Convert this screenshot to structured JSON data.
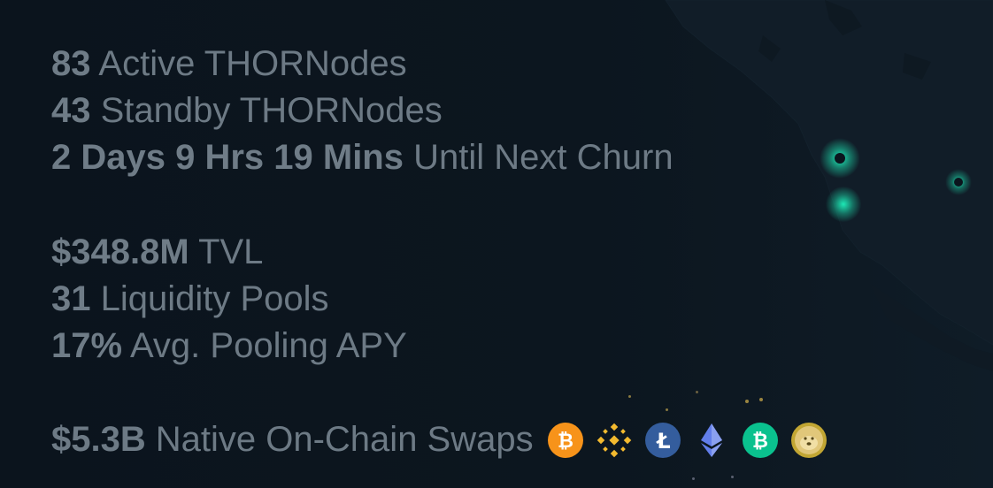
{
  "stats": {
    "active": {
      "value": "83",
      "label": "Active THORNodes"
    },
    "standby": {
      "value": "43",
      "label": "Standby THORNodes"
    },
    "churn": {
      "value": "2 Days 9 Hrs 19 Mins",
      "label": "Until Next Churn"
    },
    "tvl": {
      "value": "$348.8M",
      "label": "TVL"
    },
    "pools": {
      "value": "31",
      "label": "Liquidity Pools"
    },
    "apy": {
      "value": "17%",
      "label": "Avg. Pooling APY"
    },
    "swaps": {
      "value": "$5.3B",
      "label": "Native On-Chain Swaps"
    }
  },
  "coin_icons": [
    "bitcoin-icon",
    "binance-icon",
    "litecoin-icon",
    "ethereum-icon",
    "bitcoin-cash-icon",
    "dogecoin-icon"
  ],
  "colors": {
    "background": "#0b141d",
    "text": "#6d7a85",
    "node_glow": "#1de9b6",
    "bitcoin": "#f7931a",
    "binance": "#f3ba2f",
    "litecoin": "#345d9d",
    "ethereum": "#627eea",
    "bitcoin_cash": "#0ac18e",
    "dogecoin": "#c2a633"
  }
}
